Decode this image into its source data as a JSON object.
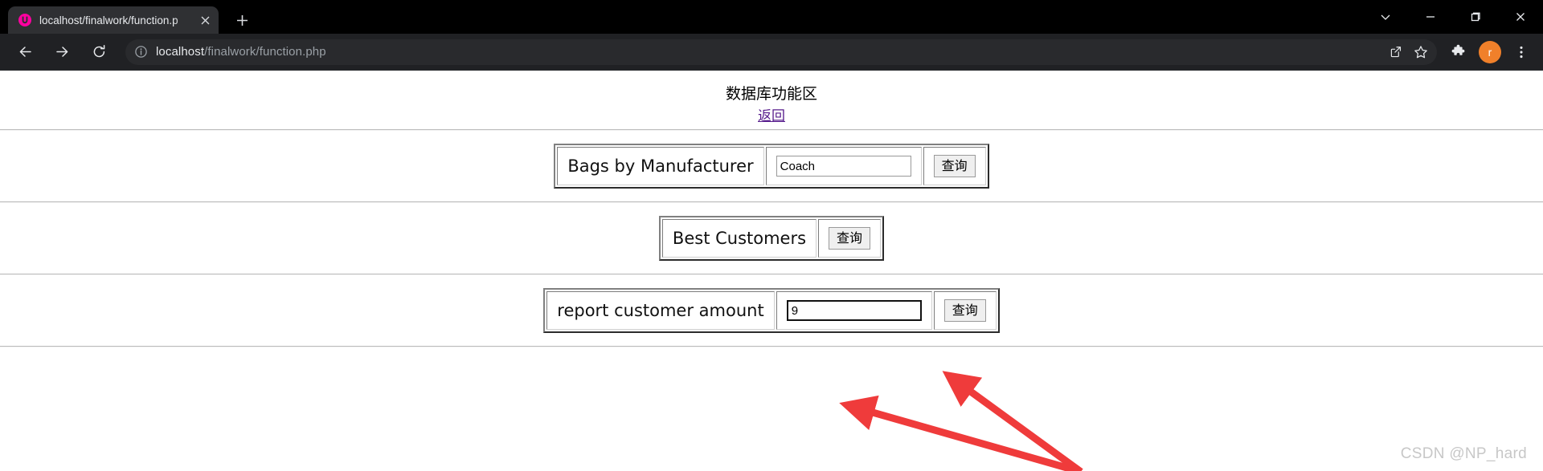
{
  "browser": {
    "tab": {
      "title": "localhost/finalwork/function.p",
      "favicon_name": "wamp-w-icon",
      "close_label": "×"
    },
    "new_tab_label": "+",
    "window_controls": {
      "tab_search_label": "⌄",
      "minimize_label": "—",
      "maximize_label": "❐",
      "close_label": "✕"
    },
    "nav": {
      "back_label": "←",
      "forward_label": "→",
      "reload_label": "⟳"
    },
    "omnibox": {
      "info_icon": "info-circle-icon",
      "host": "localhost",
      "path": "/finalwork/function.php",
      "full_url": "localhost/finalwork/function.php",
      "share_icon": "share-icon",
      "bookmark_icon": "star-bookmark-icon"
    },
    "toolbar_right": {
      "extensions_icon": "puzzle-extensions-icon",
      "profile_initial": "r",
      "menu_icon": "three-dot-menu-icon"
    }
  },
  "page": {
    "title": "数据库功能区",
    "back_link": "返回",
    "rows": [
      {
        "label": "Bags by Manufacturer",
        "has_input": true,
        "input_value": "Coach",
        "input_placeholder": "",
        "input_focused": false,
        "button_label": "查询"
      },
      {
        "label": "Best Customers",
        "has_input": false,
        "input_value": "",
        "input_placeholder": "",
        "input_focused": false,
        "button_label": "查询"
      },
      {
        "label": "report customer amount",
        "has_input": true,
        "input_value": "9",
        "input_placeholder": "",
        "input_focused": true,
        "button_label": "查询"
      }
    ]
  },
  "annotations": {
    "arrow_color": "#ef3b3b",
    "arrow_count": 2,
    "watermark": "CSDN @NP_hard"
  }
}
